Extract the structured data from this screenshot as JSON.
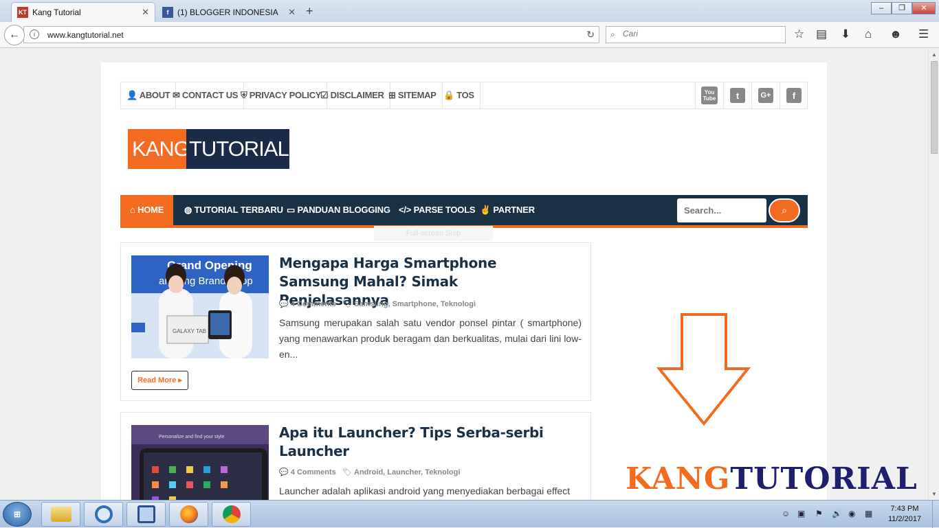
{
  "browser": {
    "tabs": [
      {
        "label": "Kang Tutorial",
        "favicon": "KT",
        "active": true
      },
      {
        "label": "(1) BLOGGER INDONESIA",
        "favicon": "f",
        "active": false
      }
    ],
    "new_tab": "+",
    "url": "www.kangtutorial.net",
    "search_placeholder": "Cari",
    "window_controls": [
      "–",
      "❐",
      "✕"
    ]
  },
  "site": {
    "top_menu": [
      {
        "icon": "user-icon",
        "glyph": "👤",
        "label": "ABOUT"
      },
      {
        "icon": "envelope-icon",
        "glyph": "✉",
        "label": "CONTACT US"
      },
      {
        "icon": "shield-icon",
        "glyph": "⛨",
        "label": "PRIVACY POLICY"
      },
      {
        "icon": "check-square-icon",
        "glyph": "☑",
        "label": "DISCLAIMER"
      },
      {
        "icon": "sitemap-icon",
        "glyph": "⊞",
        "label": "SITEMAP"
      },
      {
        "icon": "lock-icon",
        "glyph": "🔒",
        "label": "TOS"
      }
    ],
    "social": [
      {
        "icon": "youtube-icon",
        "glyph": "You Tube"
      },
      {
        "icon": "twitter-icon",
        "glyph": "t"
      },
      {
        "icon": "google-plus-icon",
        "glyph": "G+"
      },
      {
        "icon": "facebook-icon",
        "glyph": "f"
      }
    ],
    "logo": {
      "part1": "KANG",
      "part2": "TUTORIAL"
    },
    "main_nav": [
      {
        "icon": "home-icon",
        "glyph": "⌂",
        "label": "HOME"
      },
      {
        "icon": "globe-icon",
        "glyph": "◍",
        "label": "TUTORIAL TERBARU"
      },
      {
        "icon": "laptop-icon",
        "glyph": "▭",
        "label": "PANDUAN BLOGGING"
      },
      {
        "icon": "code-icon",
        "glyph": "</>",
        "label": "PARSE TOOLS"
      },
      {
        "icon": "handshake-icon",
        "glyph": "✌",
        "label": "PARTNER"
      }
    ],
    "nav_search_placeholder": "Search...",
    "ghost_tooltip": "Full-screen Snip",
    "posts": [
      {
        "title": "Mengapa Harga Smartphone Samsung Mahal? Simak Penjelasannya",
        "comments": "4 Comments",
        "labels": "Samsung, Smartphone, Teknologi",
        "excerpt": "Samsung  merupakan salah satu vendor ponsel pintar ( smartphone)  yang menawarkan produk beragam dan berkualitas, mulai dari lini low-en...",
        "read_more": "Read More",
        "thumb_text": "Grand Opening Samsung Brand Shop",
        "thumb_device": "GALAXY TAB"
      },
      {
        "title": "Apa itu Launcher? Tips Serba-serbi Launcher",
        "comments": "4 Comments",
        "labels": "Android, Launcher, Teknologi",
        "excerpt": "Launcher adalah aplikasi android yang menyediakan berbagai effect",
        "thumb_text": "Personalize and find your style"
      }
    ],
    "watermark": {
      "part1": "KANG",
      "part2": "TUTORIAL"
    }
  },
  "taskbar": {
    "clock_time": "7:43 PM",
    "clock_date": "11/2/2017"
  },
  "colors": {
    "accent": "#f26b21",
    "navy": "#1a3044"
  }
}
